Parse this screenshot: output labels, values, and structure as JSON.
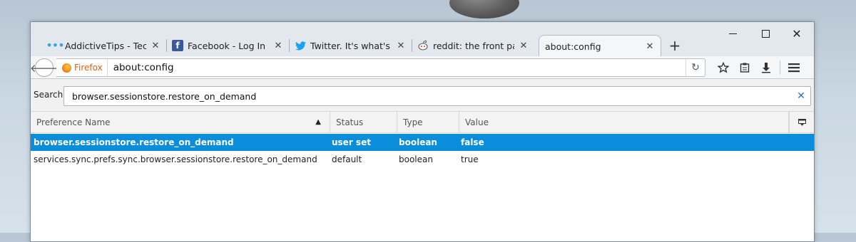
{
  "tabs": [
    {
      "label": "AddictiveTips - Tec...",
      "icon": "addictivetips-icon"
    },
    {
      "label": "Facebook - Log In ...",
      "icon": "facebook-icon"
    },
    {
      "label": "Twitter. It's what's ...",
      "icon": "twitter-icon"
    },
    {
      "label": "reddit: the front pa...",
      "icon": "reddit-icon"
    },
    {
      "label": "about:config",
      "icon": "",
      "active": true
    }
  ],
  "urlbar": {
    "identity": "Firefox",
    "url": "about:config"
  },
  "search": {
    "label": "Search:",
    "value": "browser.sessionstore.restore_on_demand"
  },
  "table": {
    "columns": [
      "Preference Name",
      "Status",
      "Type",
      "Value"
    ],
    "sort": "ascending",
    "rows": [
      {
        "name": "browser.sessionstore.restore_on_demand",
        "status": "user set",
        "type": "boolean",
        "value": "false",
        "selected": true
      },
      {
        "name": "services.sync.prefs.sync.browser.sessionstore.restore_on_demand",
        "status": "default",
        "type": "boolean",
        "value": "true",
        "selected": false
      }
    ]
  },
  "colors": {
    "selection": "#0a8ddb",
    "firefox_identity": "#e66000"
  }
}
